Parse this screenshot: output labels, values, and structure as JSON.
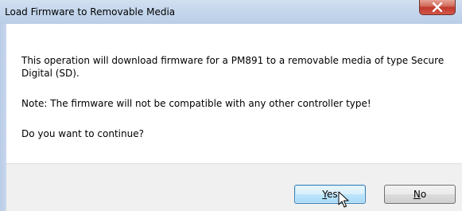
{
  "dialog": {
    "title": "Load Firmware to Removable Media",
    "message_line1": "This operation will download firmware for a PM891 to a removable media of type Secure Digital (SD).",
    "message_note": "Note: The firmware will not be compatible with any other controller type!",
    "message_question": "Do you want to continue?"
  },
  "buttons": {
    "yes": {
      "mnemonic": "Y",
      "rest": "es"
    },
    "no": {
      "mnemonic": "N",
      "rest": "o"
    }
  },
  "icons": {
    "close": "close-icon",
    "cursor": "mouse-pointer-icon"
  },
  "colors": {
    "title_bar": "#c4d6ec",
    "close_button": "#c0392b",
    "default_button_border": "#3c7fb1",
    "button_bar": "#f0f0f0"
  }
}
